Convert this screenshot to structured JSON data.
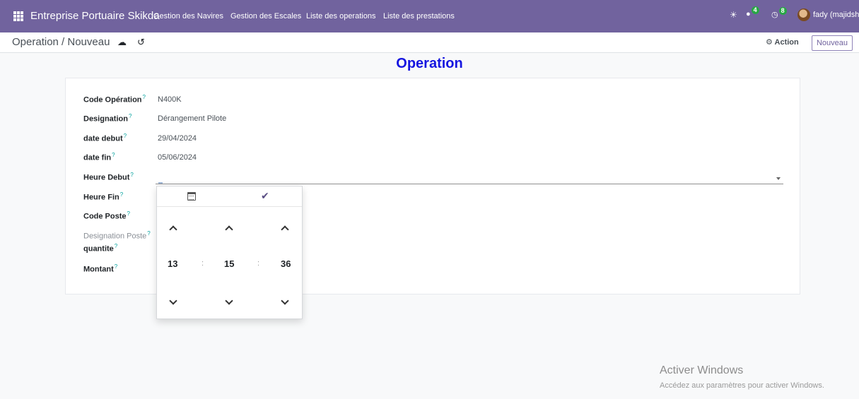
{
  "navbar": {
    "brand": "Entreprise Portuaire Skikda",
    "menu": [
      "Gestion des Navires",
      "Gestion des Escales",
      "Liste des operations",
      "Liste des prestations"
    ],
    "messages_count": "4",
    "activities_count": "8",
    "user": "fady (majidsh)",
    "color": "#71639e"
  },
  "control_panel": {
    "breadcrumb": "Operation / Nouveau",
    "action_label": "Action",
    "new_label": "Nouveau"
  },
  "form": {
    "title": "Operation",
    "help_marker": "?",
    "fields": [
      {
        "label": "Code Opération",
        "value": "N400K"
      },
      {
        "label": "Designation",
        "value": "Dérangement Pilote"
      },
      {
        "label": "date debut",
        "value": "29/04/2024"
      },
      {
        "label": "date fin",
        "value": "05/06/2024"
      },
      {
        "label": "Heure Debut",
        "value": ""
      },
      {
        "label": "Heure Fin",
        "value": ""
      },
      {
        "label": "Code Poste",
        "value": ""
      },
      {
        "label": "Designation Poste",
        "value": ""
      },
      {
        "label": "quantite",
        "value": ""
      },
      {
        "label": "Montant",
        "value": ""
      }
    ]
  },
  "time_picker": {
    "hours": "13",
    "minutes": "15",
    "seconds": "36",
    "separator": ":"
  },
  "watermark": {
    "title": "Activer Windows",
    "subtitle": "Accédez aux paramètres pour activer Windows."
  }
}
